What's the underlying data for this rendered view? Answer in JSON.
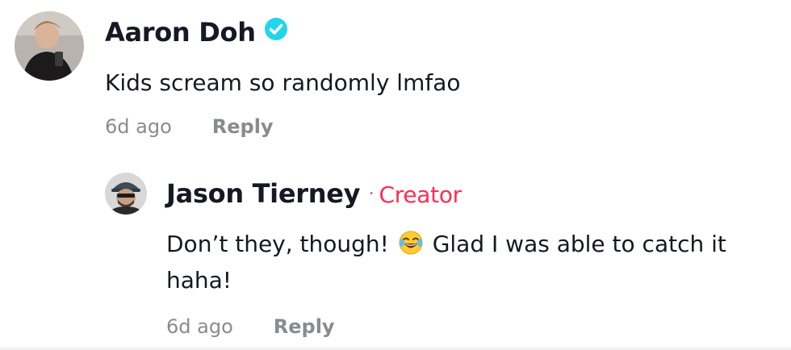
{
  "comment": {
    "author": "Aaron Doh",
    "verified_icon": "verified-badge-icon",
    "text": "Kids scream so randomly lmfao",
    "timestamp": "6d ago",
    "reply_label": "Reply",
    "avatar_icon": "user-avatar"
  },
  "reply": {
    "author": "Jason Tierney",
    "separator": "·",
    "creator_label": "Creator",
    "text_before_emoji": "Don’t they, though! ",
    "emoji_icon": "tears-of-joy-emoji-icon",
    "text_after_emoji": " Glad I was able to catch it haha!",
    "timestamp": "6d ago",
    "reply_label": "Reply",
    "avatar_icon": "user-avatar"
  },
  "colors": {
    "text": "#161823",
    "muted": "#8a8b91",
    "creator": "#fe2c55",
    "verified": "#20d5ec"
  }
}
